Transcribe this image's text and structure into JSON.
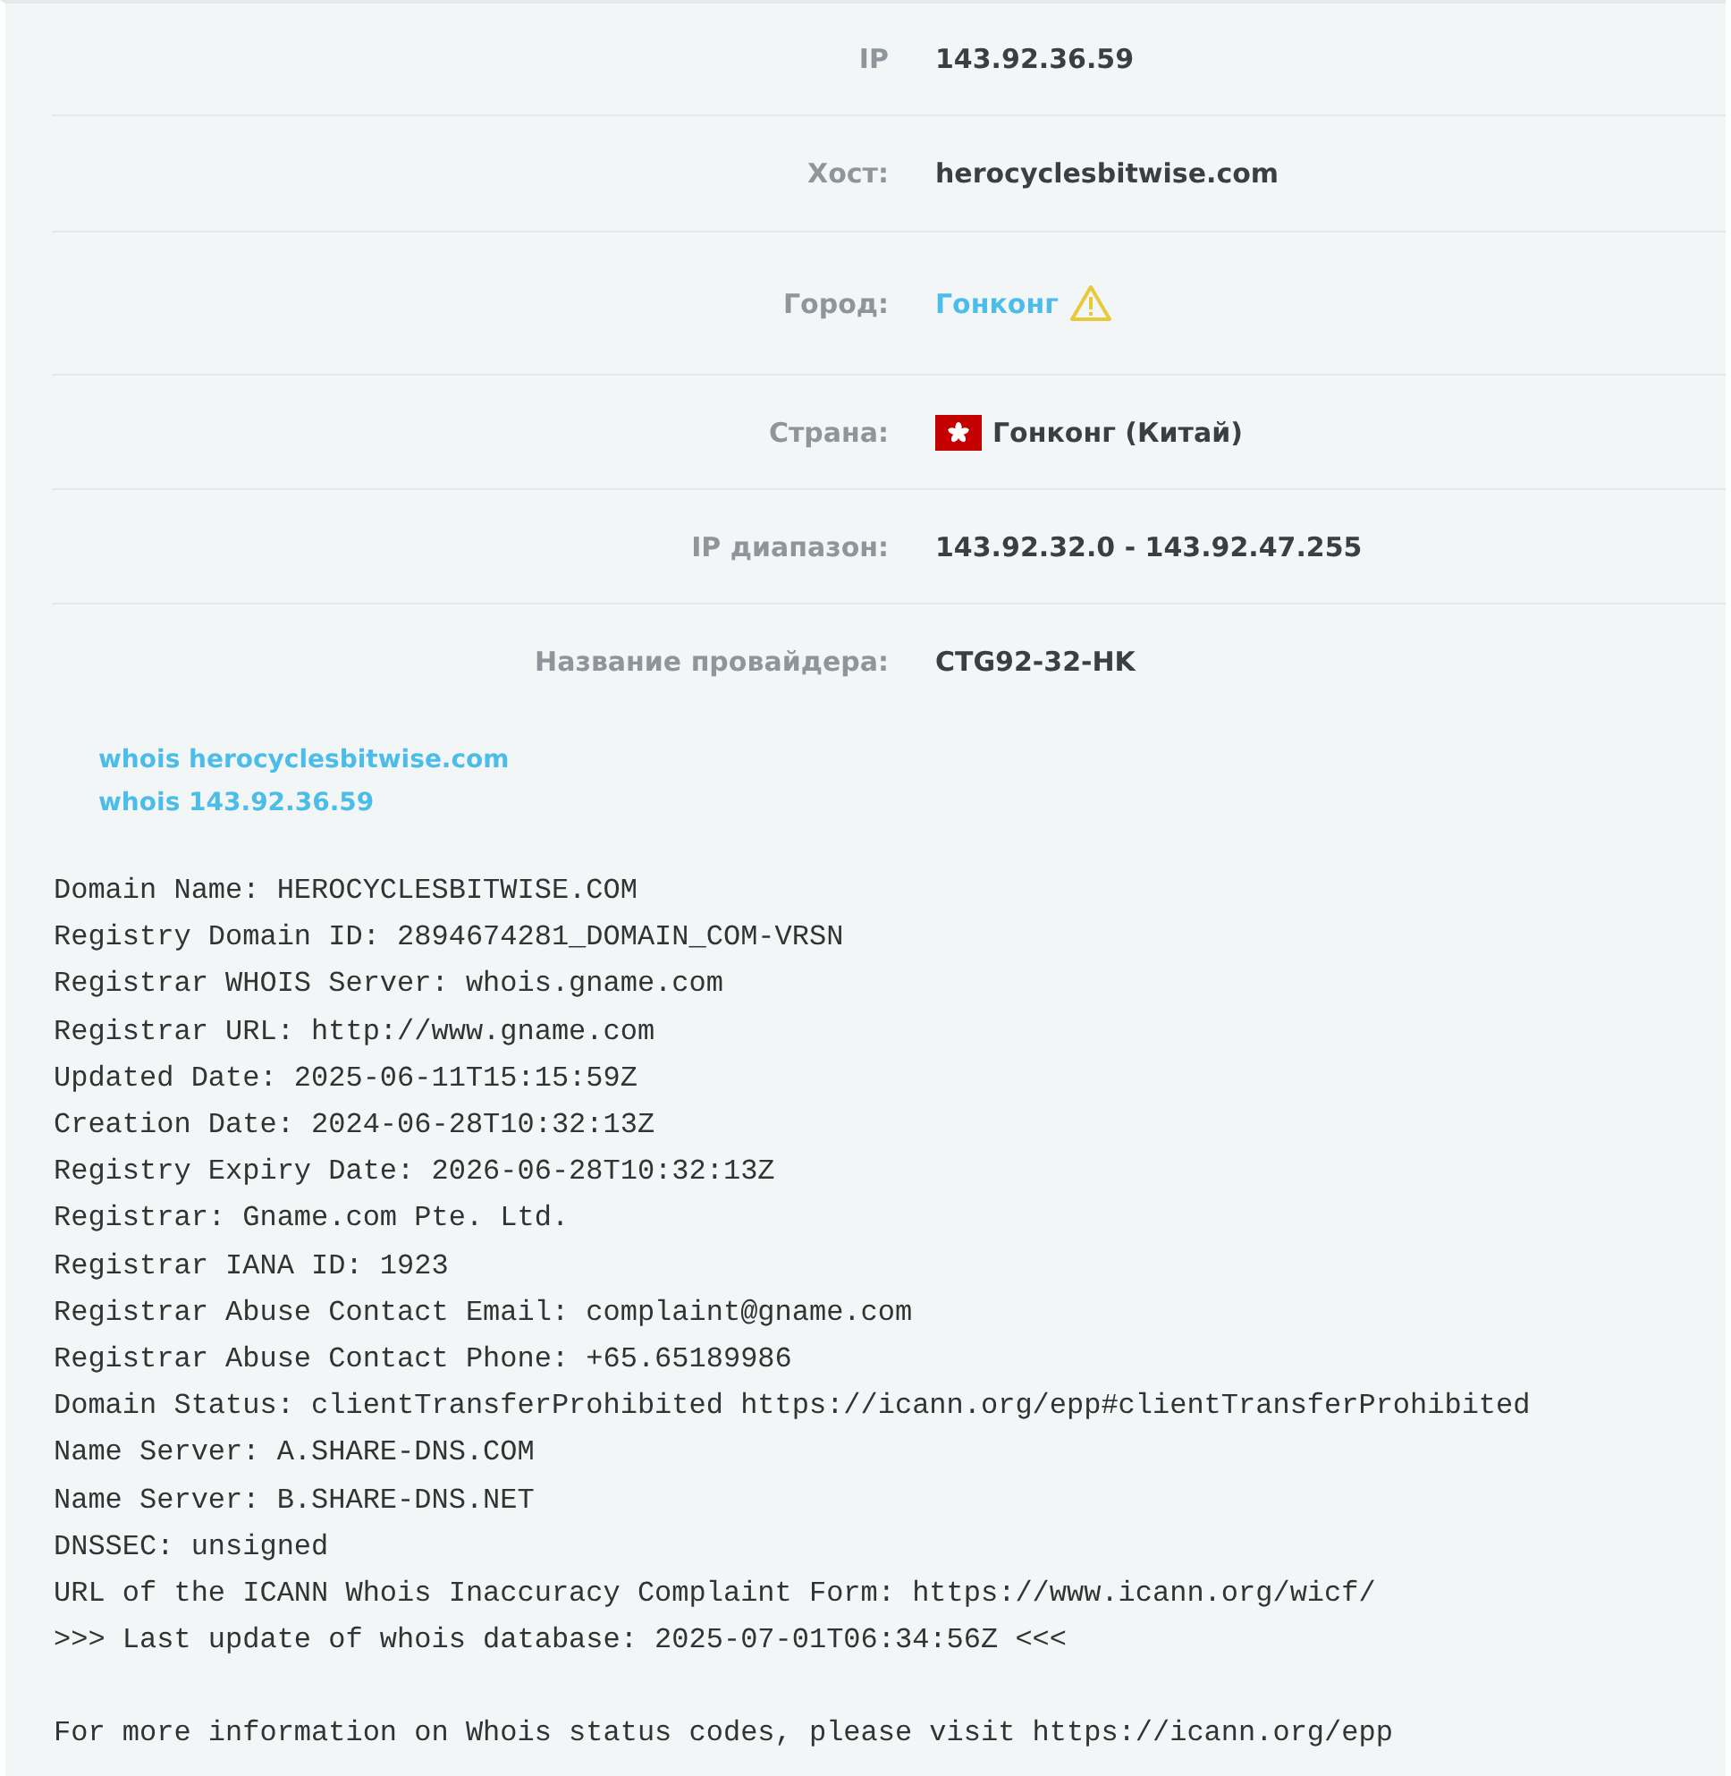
{
  "info_rows": [
    {
      "kind": "text",
      "label": "IP",
      "value": "143.92.36.59"
    },
    {
      "kind": "text",
      "label": "Хост:",
      "value": "herocyclesbitwise.com"
    },
    {
      "kind": "warning-link",
      "label": "Город:",
      "value": "Гонконг"
    },
    {
      "kind": "flag",
      "label": "Страна:",
      "value": "Гонконг (Китай)"
    },
    {
      "kind": "text",
      "label": "IP диапазон:",
      "value": "143.92.32.0 - 143.92.47.255"
    },
    {
      "kind": "text",
      "label": "Название провайдера:",
      "value": "CTG92-32-HK"
    }
  ],
  "whois_links": [
    "whois herocyclesbitwise.com",
    "whois 143.92.36.59"
  ],
  "whois_lines": [
    "Domain Name: HEROCYCLESBITWISE.COM",
    "Registry Domain ID: 2894674281_DOMAIN_COM-VRSN",
    "Registrar WHOIS Server: whois.gname.com",
    "Registrar URL: http://www.gname.com",
    "Updated Date: 2025-06-11T15:15:59Z",
    "Creation Date: 2024-06-28T10:32:13Z",
    "Registry Expiry Date: 2026-06-28T10:32:13Z",
    "Registrar: Gname.com Pte. Ltd.",
    "Registrar IANA ID: 1923",
    "Registrar Abuse Contact Email: complaint@gname.com",
    "Registrar Abuse Contact Phone: +65.65189986",
    "Domain Status: clientTransferProhibited https://icann.org/epp#clientTransferProhibited",
    "Name Server: A.SHARE-DNS.COM",
    "Name Server: B.SHARE-DNS.NET",
    "DNSSEC: unsigned",
    "URL of the ICANN Whois Inaccuracy Complaint Form: https://www.icann.org/wicf/",
    ">>> Last update of whois database: 2025-07-01T06:34:56Z <<<"
  ],
  "whois_footer": "For more information on Whois status codes, please visit https://icann.org/epp"
}
